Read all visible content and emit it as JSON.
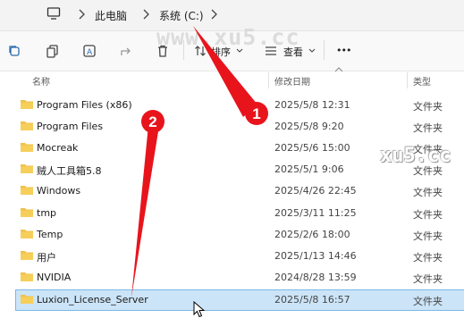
{
  "address": {
    "crumbs": [
      "此电脑",
      "系统 (C:)"
    ]
  },
  "toolbar": {
    "sort_label": "排序",
    "view_label": "查看",
    "more_label": "•••"
  },
  "columns": {
    "name": "名称",
    "modified": "修改日期",
    "type": "类型"
  },
  "files": [
    {
      "name": "Program Files (x86)",
      "modified": "2025/5/8 12:31",
      "type": "文件夹"
    },
    {
      "name": "Program Files",
      "modified": "2025/5/8 9:20",
      "type": "文件夹"
    },
    {
      "name": "Mocreak",
      "modified": "2025/5/6 15:00",
      "type": "文件夹"
    },
    {
      "name": "贼人工具箱5.8",
      "modified": "2025/5/1 9:06",
      "type": "文件夹"
    },
    {
      "name": "Windows",
      "modified": "2025/4/26 22:45",
      "type": "文件夹"
    },
    {
      "name": "tmp",
      "modified": "2025/3/11 11:25",
      "type": "文件夹"
    },
    {
      "name": "Temp",
      "modified": "2025/2/6 18:00",
      "type": "文件夹"
    },
    {
      "name": "用户",
      "modified": "2025/1/13 14:46",
      "type": "文件夹"
    },
    {
      "name": "NVIDIA",
      "modified": "2024/8/28 13:59",
      "type": "文件夹"
    },
    {
      "name": "Luxion_License_Server",
      "modified": "2025/5/8 16:57",
      "type": "文件夹",
      "selected": true
    }
  ],
  "annotations": {
    "badge1": "1",
    "badge2": "2"
  },
  "watermark": {
    "top": "www.xu5.cc",
    "side": "xu5.cc"
  },
  "colors": {
    "folder": "#f0c14b",
    "selection": "#cce4f7",
    "annotation": "#e8141c"
  }
}
